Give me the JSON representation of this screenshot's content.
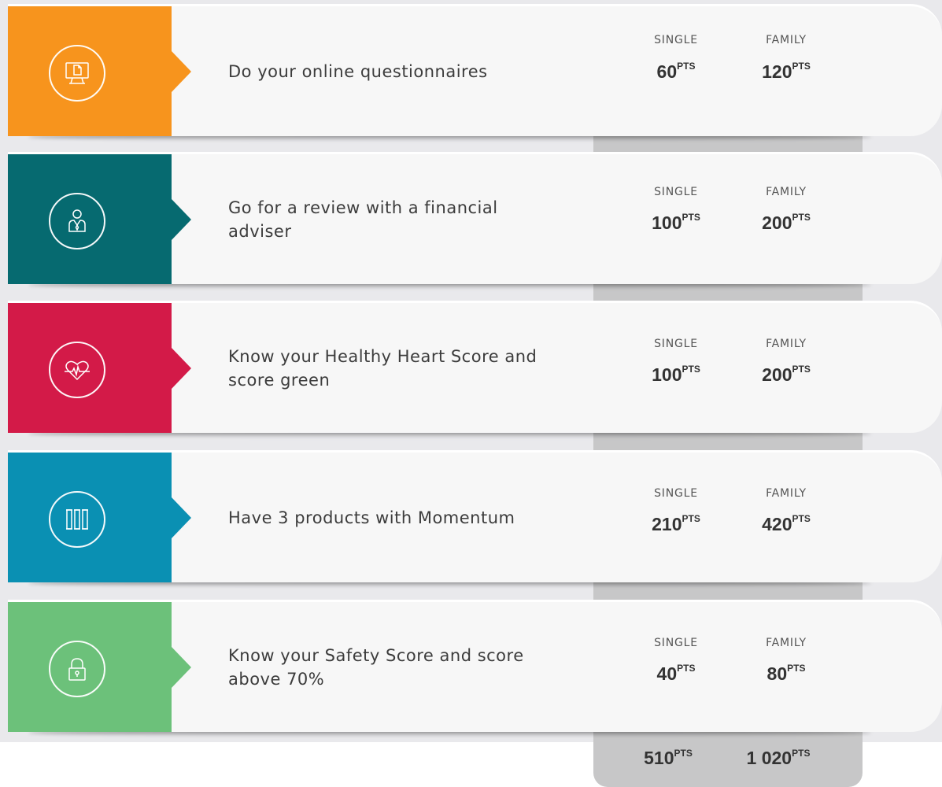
{
  "colors": {
    "orange": "#f7941d",
    "teal": "#066a70",
    "crimson": "#d31a48",
    "blue": "#0a90b3",
    "green": "#6cc17a"
  },
  "columns": {
    "single": "SINGLE",
    "family": "FAMILY"
  },
  "pts_suffix": "PTS",
  "rows": [
    {
      "icon": "computer-document-icon",
      "label": "Do your online questionnaires",
      "single": "60",
      "family": "120"
    },
    {
      "icon": "financial-adviser-icon",
      "label": "Go for a review with a financial adviser",
      "single": "100",
      "family": "200"
    },
    {
      "icon": "heart-pulse-icon",
      "label": "Know your Healthy Heart Score and score green",
      "single": "100",
      "family": "200"
    },
    {
      "icon": "three-products-icon",
      "label": "Have 3 products with Momentum",
      "single": "210",
      "family": "420"
    },
    {
      "icon": "padlock-icon",
      "label": "Know your Safety Score and score above 70%",
      "single": "40",
      "family": "80"
    }
  ],
  "totals": {
    "single": "510",
    "family": "1 020"
  }
}
